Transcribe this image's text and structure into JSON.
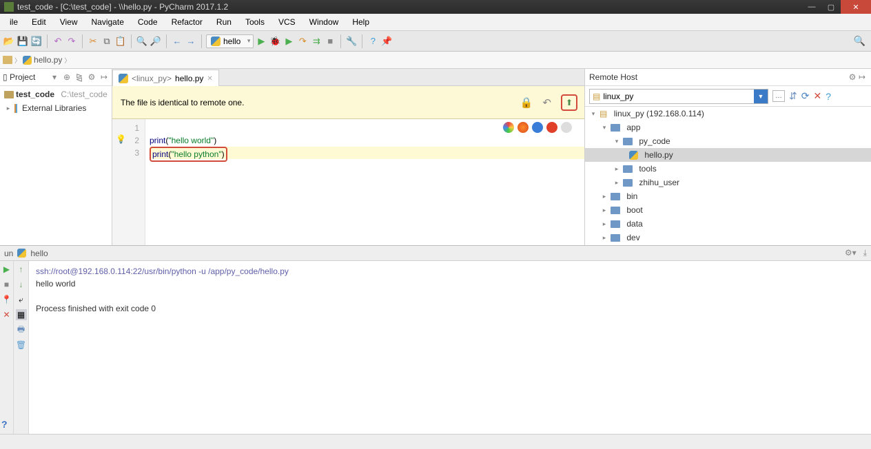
{
  "window": {
    "title": "test_code - [C:\\test_code] - \\\\hello.py - PyCharm 2017.1.2"
  },
  "menu": [
    "ile",
    "Edit",
    "View",
    "Navigate",
    "Code",
    "Refactor",
    "Run",
    "Tools",
    "VCS",
    "Window",
    "Help"
  ],
  "toolbar": {
    "run_config": "hello"
  },
  "breadcrumb": {
    "file": "hello.py"
  },
  "project": {
    "title": "Project",
    "root": "test_code",
    "root_path": "C:\\test_code",
    "libs": "External Libraries"
  },
  "editor": {
    "tab_prefix": "<linux_py>",
    "tab_name": "hello.py",
    "notice": "The file is identical to remote one.",
    "lines": [
      "",
      "print(\"hello world\")",
      "print(\"hello python\")"
    ]
  },
  "remote": {
    "title": "Remote Host",
    "host": "linux_py",
    "root": "linux_py (192.168.0.114)",
    "app": "app",
    "py_code": "py_code",
    "hello": "hello.py",
    "tools": "tools",
    "zhihu": "zhihu_user",
    "bin": "bin",
    "boot": "boot",
    "data": "data",
    "dev": "dev"
  },
  "run": {
    "tab": "hello",
    "cmd": "ssh://root@192.168.0.114:22/usr/bin/python -u /app/py_code/hello.py",
    "out": "hello world",
    "exit": "Process finished with exit code 0"
  }
}
